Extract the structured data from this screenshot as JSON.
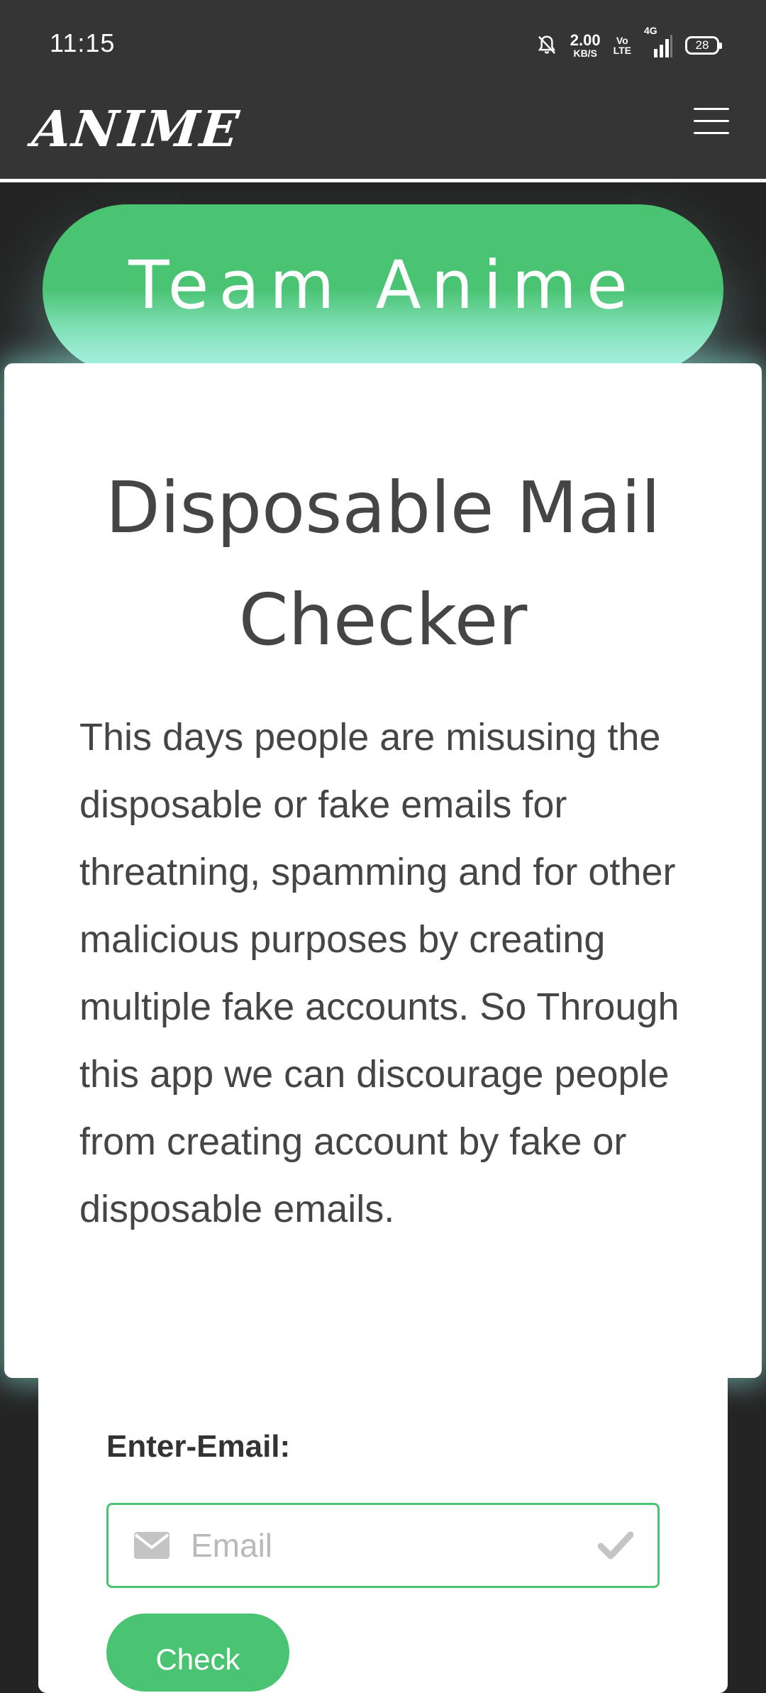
{
  "status_bar": {
    "time": "11:15",
    "net_speed_value": "2.00",
    "net_speed_unit": "KB/S",
    "volte_top": "Vo",
    "volte_bottom": "LTE",
    "network_type": "4G",
    "battery_level": "28",
    "icons": [
      "bell-off-icon",
      "signal-icon",
      "battery-icon"
    ]
  },
  "navbar": {
    "brand": "ANIME",
    "menu_icon": "hamburger-menu-icon"
  },
  "banner": {
    "title": "Team Anime"
  },
  "info_card": {
    "title": "Disposable Mail Checker",
    "description": "This days people are misusing the disposable or fake emails for threatning, spamming and for other malicious purposes by creating multiple fake accounts. So Through this app we can discourage people from creating account by fake or disposable emails."
  },
  "form": {
    "label": "Enter-Email:",
    "email_placeholder": "Email",
    "email_value": "",
    "leading_icon": "envelope-icon",
    "trailing_icon": "check-icon",
    "submit_label": "Check"
  },
  "colors": {
    "accent_green": "#4ac373",
    "navbar_bg": "#353535",
    "page_bg": "#242424",
    "glow": "#b4f3e3",
    "text_dark": "#454545"
  }
}
